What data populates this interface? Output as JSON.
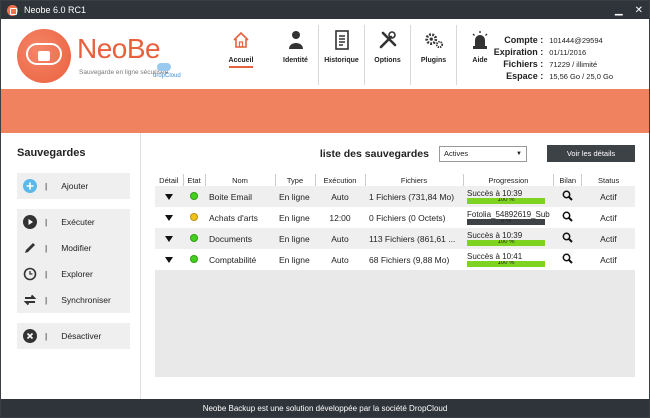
{
  "window": {
    "title": "Neobe  6.0 RC1"
  },
  "logo": {
    "brand": "NeoBe",
    "tagline": "Sauvegarde en ligne sécurisée",
    "partner": "dropCloud"
  },
  "nav": [
    {
      "label": "Accueil",
      "icon": "home-icon"
    },
    {
      "label": "Identité",
      "icon": "user-icon"
    },
    {
      "label": "Historique",
      "icon": "document-icon"
    },
    {
      "label": "Options",
      "icon": "tools-icon"
    },
    {
      "label": "Plugins",
      "icon": "gears-icon"
    },
    {
      "label": "Aide",
      "icon": "alarm-icon"
    }
  ],
  "account": [
    {
      "key": "Compte :",
      "value": "101444@29594"
    },
    {
      "key": "Expiration :",
      "value": "01/11/2016"
    },
    {
      "key": "Fichiers :",
      "value": "71229 / illimité"
    },
    {
      "key": "Espace :",
      "value": "15,56 Go / 25,0 Go"
    }
  ],
  "sidebar": {
    "title": "Sauvegardes",
    "add": "Ajouter",
    "run": "Exécuter",
    "edit": "Modifier",
    "explore": "Explorer",
    "sync": "Synchroniser",
    "disable": "Désactiver"
  },
  "list": {
    "title": "liste des sauvegardes",
    "filter": "Actives",
    "details_button": "Voir les détails",
    "columns": [
      "Détail",
      "Etat",
      "Nom",
      "Type",
      "Exécution",
      "Fichiers",
      "Progression",
      "Bilan",
      "Status"
    ],
    "rows": [
      {
        "state": "green",
        "name": "Boite Email",
        "type": "En ligne",
        "exec": "Auto",
        "files": "1 Fichiers (731,84 Mo)",
        "progress_text": "Succès à 10:39",
        "progress": 100,
        "progress_label": "100 %",
        "status": "Actif"
      },
      {
        "state": "yellow",
        "name": "Achats d'arts",
        "type": "En ligne",
        "exec": "12:00",
        "files": "0 Fichiers (0 Octets)",
        "progress_text": "Fotolia_54892619_Sub",
        "progress": 0,
        "progress_label": "0 %",
        "status": "Actif"
      },
      {
        "state": "green",
        "name": "Documents",
        "type": "En ligne",
        "exec": "Auto",
        "files": "113 Fichiers (861,61 ...",
        "progress_text": "Succès à 10:39",
        "progress": 100,
        "progress_label": "100 %",
        "status": "Actif"
      },
      {
        "state": "green",
        "name": "Comptabilité",
        "type": "En ligne",
        "exec": "Auto",
        "files": "68 Fichiers (9,88 Mo)",
        "progress_text": "Succès à 10:41",
        "progress": 100,
        "progress_label": "100 %",
        "status": "Actif"
      }
    ]
  },
  "footer": "Neobe Backup est une solution développée par la société DropCloud",
  "colors": {
    "accent": "#f0825f",
    "dark": "#2f343a",
    "green": "#43d11d",
    "yellow": "#f2c21b",
    "progress": "#7ed321"
  }
}
